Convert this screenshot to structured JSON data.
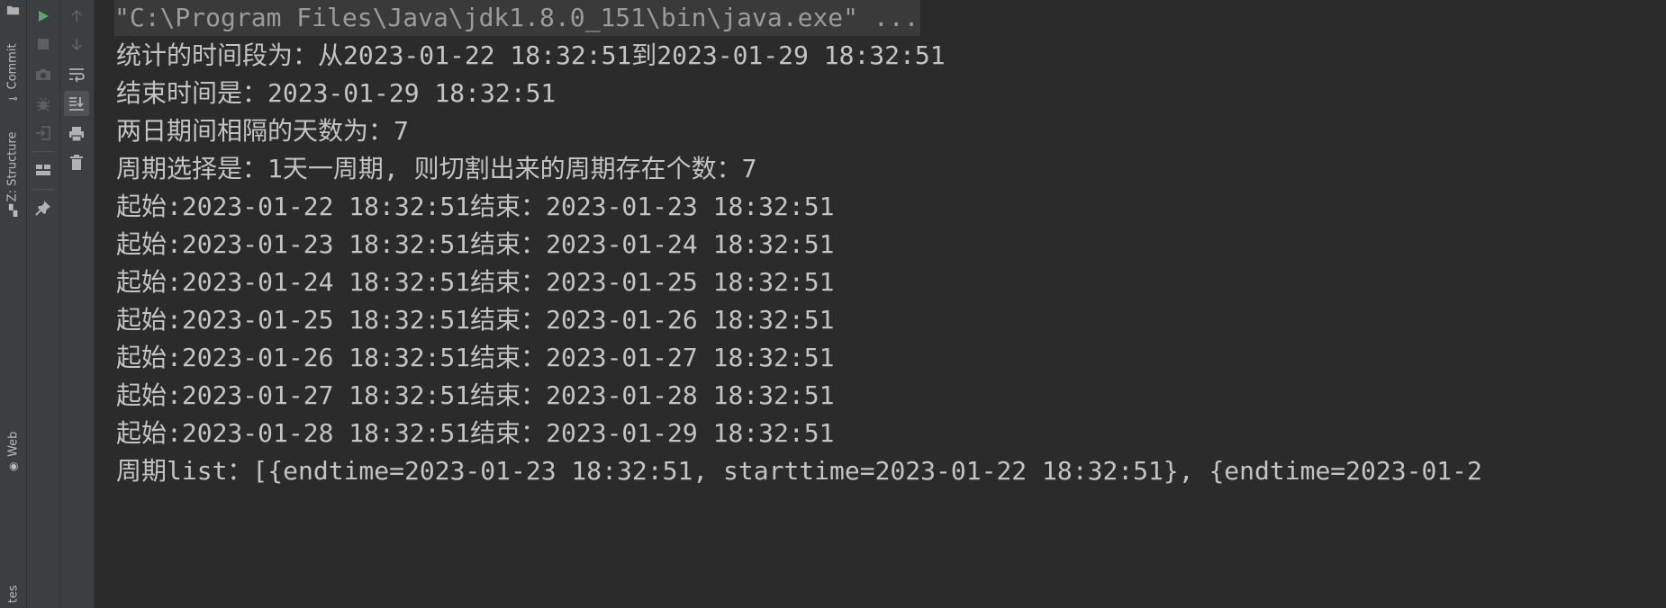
{
  "side_stripe": {
    "top_icon": "folder-icon",
    "tabs": [
      {
        "label": "Commit",
        "icon": "commit-icon"
      },
      {
        "label": "Z: Structure",
        "icon": "structure-icon"
      },
      {
        "label": "Web",
        "icon": "web-icon"
      },
      {
        "label": "tes",
        "icon": ""
      }
    ]
  },
  "toolbar_left": {
    "buttons": [
      "run-icon",
      "stop-icon",
      "camera-icon",
      "debug-icon",
      "exit-icon",
      "layout-icon",
      "pin-icon"
    ]
  },
  "toolbar_right": {
    "buttons": [
      "up-arrow-icon",
      "down-arrow-icon",
      "soft-wrap-icon",
      "scroll-to-end-icon",
      "print-icon",
      "trash-icon"
    ]
  },
  "console": {
    "command": "\"C:\\Program Files\\Java\\jdk1.8.0_151\\bin\\java.exe\" ...",
    "lines": [
      "统计的时间段为：从2023-01-22 18:32:51到2023-01-29 18:32:51",
      "结束时间是：2023-01-29 18:32:51",
      "两日期间相隔的天数为：7",
      "周期选择是：1天一周期, 则切割出来的周期存在个数：7",
      "起始:2023-01-22 18:32:51结束：2023-01-23 18:32:51",
      "起始:2023-01-23 18:32:51结束：2023-01-24 18:32:51",
      "起始:2023-01-24 18:32:51结束：2023-01-25 18:32:51",
      "起始:2023-01-25 18:32:51结束：2023-01-26 18:32:51",
      "起始:2023-01-26 18:32:51结束：2023-01-27 18:32:51",
      "起始:2023-01-27 18:32:51结束：2023-01-28 18:32:51",
      "起始:2023-01-28 18:32:51结束：2023-01-29 18:32:51",
      "周期list：[{endtime=2023-01-23 18:32:51, starttime=2023-01-22 18:32:51}, {endtime=2023-01-2"
    ]
  },
  "colors": {
    "background": "#2b2b2b",
    "panel": "#3c3f41",
    "text": "#c4c4c4",
    "run_green": "#59a869",
    "icon_gray": "#afb1b3"
  }
}
